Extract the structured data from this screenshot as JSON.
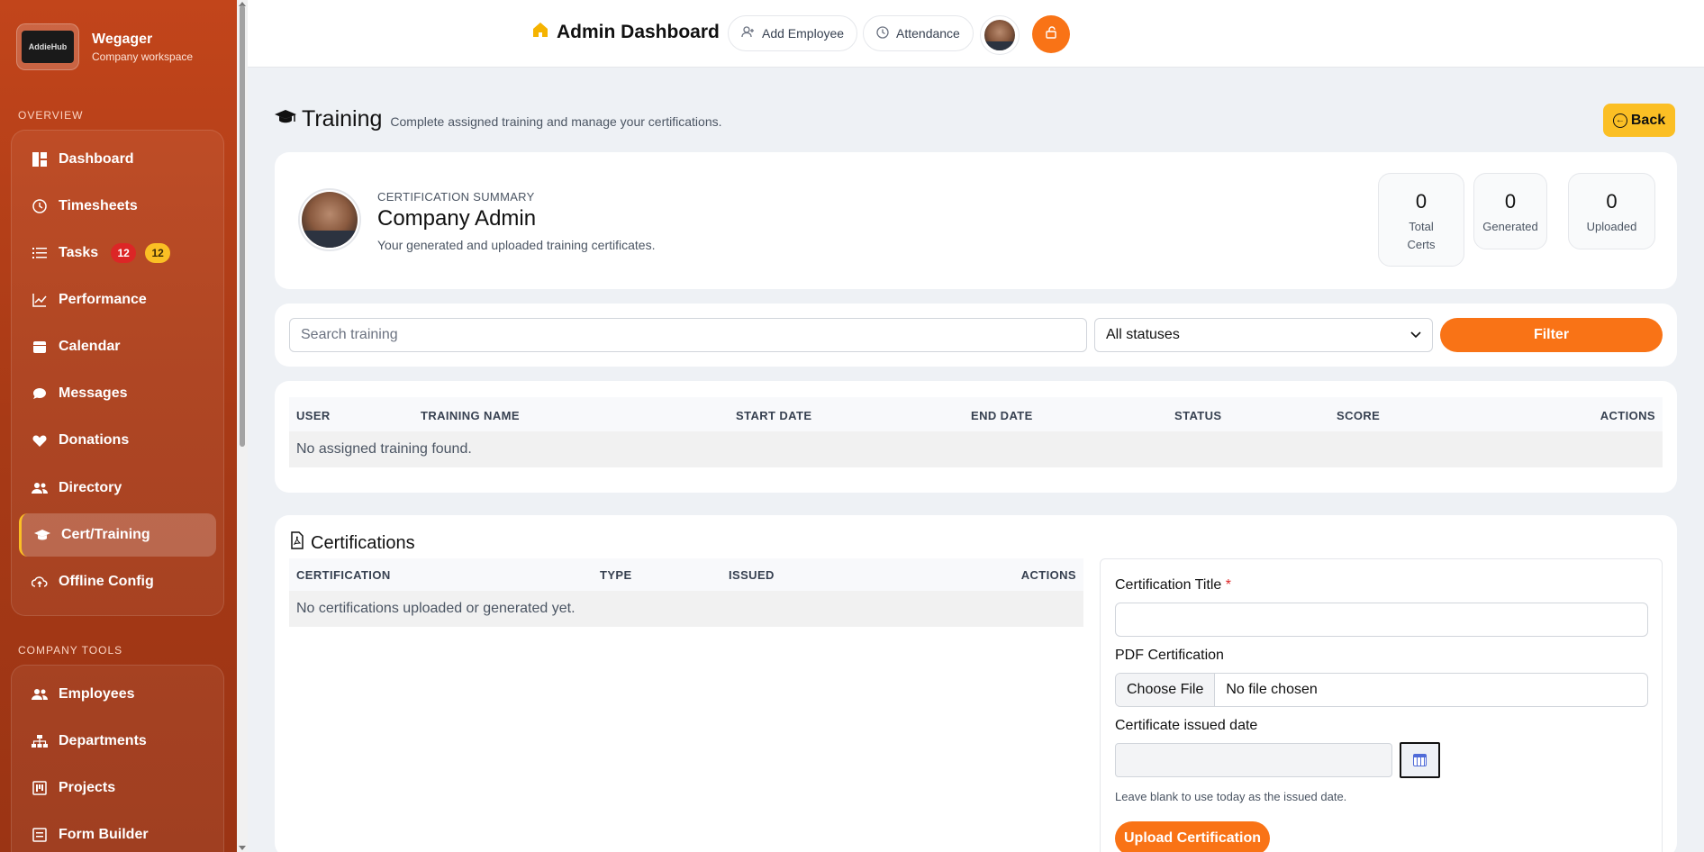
{
  "sidebar": {
    "brand_name": "Wegager",
    "brand_sub": "Company workspace",
    "logo_text": "AddieHub",
    "overview_title": "OVERVIEW",
    "items": [
      {
        "label": "Dashboard",
        "icon": "dashboard-icon"
      },
      {
        "label": "Timesheets",
        "icon": "clock-icon"
      },
      {
        "label": "Tasks",
        "icon": "list-icon",
        "badges": [
          "12",
          "12"
        ]
      },
      {
        "label": "Performance",
        "icon": "chart-line-icon"
      },
      {
        "label": "Calendar",
        "icon": "calendar-icon"
      },
      {
        "label": "Messages",
        "icon": "chat-icon"
      },
      {
        "label": "Donations",
        "icon": "heart-icon"
      },
      {
        "label": "Directory",
        "icon": "people-icon"
      },
      {
        "label": "Cert/Training",
        "icon": "graduation-cap-icon",
        "active": true
      },
      {
        "label": "Offline Config",
        "icon": "cloud-upload-icon"
      }
    ],
    "tools_title": "COMPANY TOOLS",
    "tools": [
      {
        "label": "Employees",
        "icon": "people-icon"
      },
      {
        "label": "Departments",
        "icon": "sitemap-icon"
      },
      {
        "label": "Projects",
        "icon": "kanban-icon"
      },
      {
        "label": "Form Builder",
        "icon": "form-icon"
      }
    ]
  },
  "topbar": {
    "title": "Admin Dashboard",
    "add_employee": "Add Employee",
    "attendance": "Attendance"
  },
  "page": {
    "title": "Training",
    "subtitle": "Complete assigned training and manage your certifications.",
    "back_label": "Back"
  },
  "summary": {
    "kicker": "CERTIFICATION SUMMARY",
    "name": "Company Admin",
    "description": "Your generated and uploaded training certificates.",
    "stats": [
      {
        "value": "0",
        "label_1": "Total",
        "label_2": "Certs"
      },
      {
        "value": "0",
        "label_1": "Generated",
        "label_2": ""
      },
      {
        "value": "0",
        "label_1": "Uploaded",
        "label_2": ""
      }
    ]
  },
  "filters": {
    "search_placeholder": "Search training",
    "status_value": "All statuses",
    "filter_label": "Filter"
  },
  "training_table": {
    "columns": [
      "USER",
      "TRAINING NAME",
      "START DATE",
      "END DATE",
      "STATUS",
      "SCORE",
      "ACTIONS"
    ],
    "empty": "No assigned training found."
  },
  "certifications": {
    "title": "Certifications",
    "columns": [
      "CERTIFICATION",
      "TYPE",
      "ISSUED",
      "ACTIONS"
    ],
    "empty": "No certifications uploaded or generated yet.",
    "form": {
      "title_label": "Certification Title",
      "required_mark": "*",
      "pdf_label": "PDF Certification",
      "choose_file": "Choose File",
      "no_file": "No file chosen",
      "date_label": "Certificate issued date",
      "date_hint": "Leave blank to use today as the issued date.",
      "upload_label": "Upload Certification"
    }
  },
  "colors": {
    "accent": "#f97316",
    "sidebar": "#b23e18",
    "back": "#fbbf24"
  }
}
